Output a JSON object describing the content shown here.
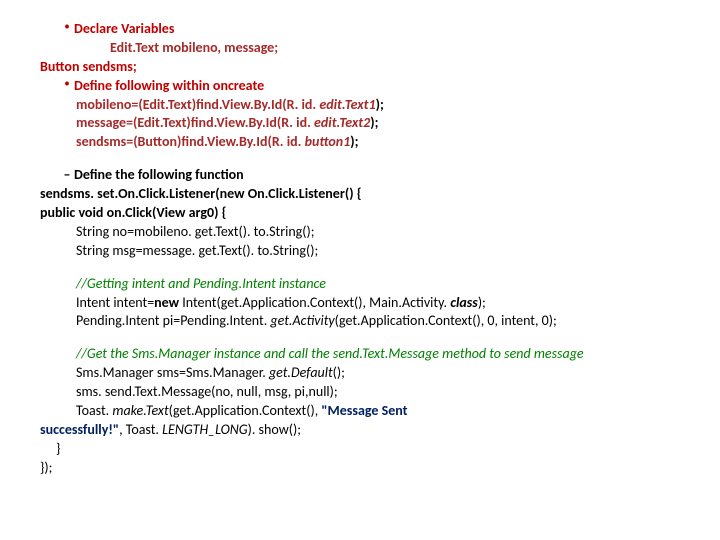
{
  "b1_label": "Declare Variables",
  "decl1": "Edit.Text mobileno, message;",
  "decl2": "Button sendsms;",
  "b2_label": "Define following within oncreate",
  "oc1_a": "mobileno=(Edit.Text)find.View.By.Id(R. id. ",
  "oc1_b": "edit.Text1",
  "oc1_c": ");",
  "oc2_a": "message=(Edit.Text)find.View.By.Id(R. id. ",
  "oc2_b": "edit.Text2",
  "oc2_c": ");",
  "oc3_a": "sendsms=(Button)find.View.By.Id(R. id. ",
  "oc3_b": "button1",
  "oc3_c": ");",
  "dash_label": "Define the following function",
  "f1_a": "sendsms. set.On.Click.Listener(",
  "f1_b": "new ",
  "f1_c": "On.Click.Listener() {",
  "f2_a": "public void ",
  "f2_b": "on.Click(View arg0) {",
  "f3": "String no=mobileno. get.Text(). to.String();",
  "f4": "String msg=message. get.Text(). to.String();",
  "c1": "//Getting intent and Pending.Intent instance",
  "i1_a": "Intent intent=",
  "i1_b": "new ",
  "i1_c": "Intent(get.Application.Context(), Main.Activity. ",
  "i1_d": "class",
  "i1_e": ");",
  "i2_a": "Pending.Intent pi=Pending.Intent. ",
  "i2_b": "get.Activity",
  "i2_c": "(get.Application.Context(), 0, intent, 0);",
  "c2": "//Get the Sms.Manager instance and call the send.Text.Message method to send message",
  "s1_a": "Sms.Manager sms=Sms.Manager. ",
  "s1_b": "get.Default",
  "s1_c": "();",
  "s2": "sms. send.Text.Message(no, null, msg, pi,null);",
  "t1_a": "Toast. ",
  "t1_b": "make.Text",
  "t1_c": "(get.Application.Context(), ",
  "t1_d": "\"Message Sent",
  "t2_a": "successfully!\"",
  "t2_b": ", Toast. ",
  "t2_c": "LENGTH_LONG",
  "t2_d": "). show();",
  "close1": "}",
  "close2": "});"
}
